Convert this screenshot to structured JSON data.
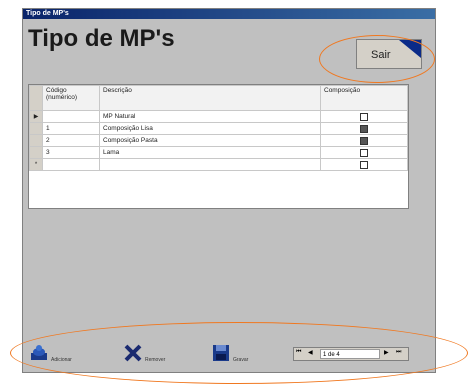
{
  "window": {
    "title": "Tipo de MP's"
  },
  "header": {
    "title": "Tipo de MP's",
    "exit_label": "Sair"
  },
  "grid": {
    "columns": [
      "Código (numérico)",
      "Descrição",
      "Composição"
    ],
    "rows": [
      {
        "marker": "▶",
        "codigo": "",
        "descricao": "MP Natural",
        "composicao": false
      },
      {
        "marker": "",
        "codigo": "1",
        "descricao": "Composição Lisa",
        "composicao": true
      },
      {
        "marker": "",
        "codigo": "2",
        "descricao": "Composição Pasta",
        "composicao": true
      },
      {
        "marker": "",
        "codigo": "3",
        "descricao": "Lama",
        "composicao": false
      },
      {
        "marker": "*",
        "codigo": "",
        "descricao": "",
        "composicao": false
      }
    ]
  },
  "toolbar": {
    "add_label": "Adicionar",
    "remove_label": "Remover",
    "save_label": "Gravar",
    "nav_position": "1 de 4"
  },
  "colors": {
    "accent": "#f07820",
    "window_bg": "#c0c0c0",
    "title_bar": "#0a246a"
  }
}
